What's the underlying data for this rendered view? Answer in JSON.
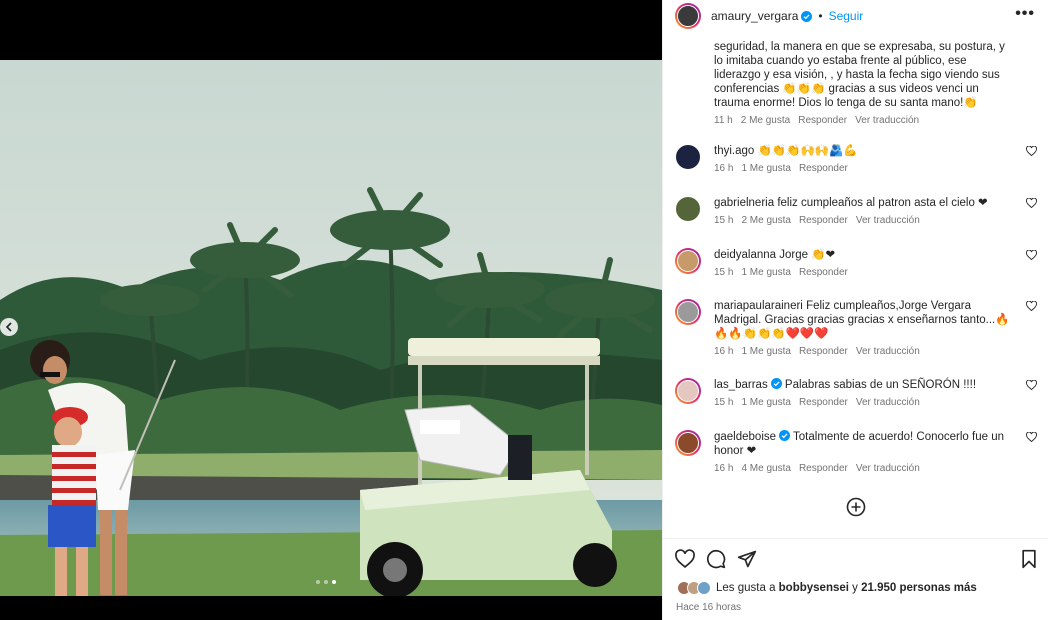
{
  "header": {
    "username": "amaury_vergara",
    "separator": "•",
    "follow_label": "Seguir",
    "more_label": "•••"
  },
  "first_comment": {
    "text": "seguridad, la manera en que se expresaba, su postura, y lo imitaba cuando yo estaba frente al público, ese liderazgo y esa visión, , y hasta la fecha sigo viendo sus conferencias 👏👏👏 gracias a sus videos venci un trauma enorme! Dios lo tenga de su santa mano!👏",
    "time": "11 h",
    "likes": "2 Me gusta",
    "reply": "Responder",
    "translate": "Ver traducción"
  },
  "comments": [
    {
      "user": "thyi.ago",
      "verified": false,
      "text": "👏👏👏🙌🙌🫂💪",
      "time": "16 h",
      "likes": "1 Me gusta",
      "reply": "Responder",
      "translate": "",
      "avatar_color": "#1c2340",
      "ring": false
    },
    {
      "user": "gabrielneria",
      "verified": false,
      "text": "feliz cumpleaños al patron asta el cielo ❤",
      "time": "15 h",
      "likes": "2 Me gusta",
      "reply": "Responder",
      "translate": "Ver traducción",
      "avatar_color": "#55653a",
      "ring": false
    },
    {
      "user": "deidyalanna",
      "verified": false,
      "text": "Jorge 👏❤",
      "time": "15 h",
      "likes": "1 Me gusta",
      "reply": "Responder",
      "translate": "",
      "avatar_color": "#c79a6a",
      "ring": true
    },
    {
      "user": "mariapaularaineri",
      "verified": false,
      "text": "Feliz cumpleaños,Jorge Vergara Madrigal. Gracias gracias gracias x enseñarnos tanto...🔥🔥🔥👏👏👏❤️❤️❤️",
      "time": "16 h",
      "likes": "1 Me gusta",
      "reply": "Responder",
      "translate": "Ver traducción",
      "avatar_color": "#9a9a9a",
      "ring": true
    },
    {
      "user": "las_barras",
      "verified": true,
      "text": "Palabras sabias de un SEÑORÓN !!!!",
      "time": "15 h",
      "likes": "1 Me gusta",
      "reply": "Responder",
      "translate": "Ver traducción",
      "avatar_color": "#e3c7c0",
      "ring": true
    },
    {
      "user": "gaeldeboise",
      "verified": true,
      "text": "Totalmente de acuerdo! Conocerlo fue un honor ❤",
      "time": "16 h",
      "likes": "4 Me gusta",
      "reply": "Responder",
      "translate": "Ver traducción",
      "avatar_color": "#8b4a2a",
      "ring": true
    }
  ],
  "likes": {
    "prefix": "Les gusta a ",
    "user": "bobbysensei",
    "middle": " y ",
    "count": "21.950 personas más"
  },
  "posted": "Hace 16 horas",
  "colors": {
    "accent": "#0095f6",
    "meta": "#737373",
    "text": "#262626"
  },
  "icons": [
    "chevron-left-icon",
    "verified-icon",
    "more-icon",
    "heart-icon",
    "comment-icon",
    "share-icon",
    "bookmark-icon",
    "add-comment-icon"
  ],
  "carousel": {
    "slides": 3,
    "active": 3
  }
}
